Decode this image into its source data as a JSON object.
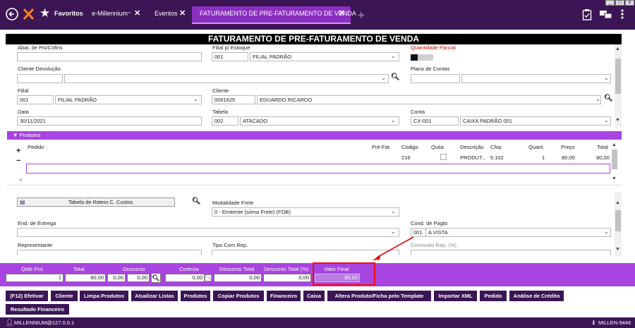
{
  "window": {
    "min": "_",
    "max": "□",
    "close": "x"
  },
  "topbar": {
    "favorites": "Favoritos",
    "tabs": [
      {
        "label": "e-Millennium"
      },
      {
        "label": "Eventos"
      },
      {
        "label": "FATURAMENTO DE PRE-FATURAMENTO DE VENDA"
      }
    ],
    "add_tab": "+"
  },
  "title": "FATURAMENTO DE PRE-FATURAMENTO DE VENDA",
  "header_form": {
    "abat": {
      "label": "Abat. de Pis/Cofins",
      "value": ""
    },
    "filial_estoque": {
      "label": "Filial p/ Estoque",
      "code": "001",
      "value": "FILIAL PADRÃO"
    },
    "qtd_parcial": {
      "label": "Quantidade Parcial"
    },
    "cliente_devolucao": {
      "label": "Cliente Devolução",
      "code": "",
      "value": ""
    },
    "plano_contas": {
      "label": "Plano de Contas",
      "code": "",
      "value": ""
    },
    "filial": {
      "label": "Filial",
      "code": "001",
      "value": "FILIAL PADRÃO"
    },
    "cliente": {
      "label": "Cliente",
      "code": "0061625",
      "value": "EDUARDO RICARDO"
    },
    "data": {
      "label": "Data",
      "value": "30/11/2021"
    },
    "tabela": {
      "label": "Tabela",
      "code": "002",
      "value": "ATACADO"
    },
    "conta": {
      "label": "Conta",
      "code": "CX-001",
      "value": "CAIXA PADRÃO 001"
    }
  },
  "produtos": {
    "title": "Produtos",
    "add": "+",
    "remove": "−",
    "more": "»",
    "columns": {
      "pedido": "Pedido",
      "pre_fat": "Pré-Fat.",
      "codigo": "Código",
      "quita": "Quita",
      "descricao": "Descrição",
      "cfop": "Cfop",
      "quant": "Quant.",
      "preco": "Preço",
      "total": "Total"
    },
    "rows": [
      {
        "pedido": "",
        "pre_fat": "",
        "codigo": "216",
        "descricao": "PRODUT...",
        "cfop": "5.102",
        "quant": "1",
        "preco": "80,00",
        "total": "80,00"
      }
    ]
  },
  "lower_form": {
    "rateio_btn": "Tabela de Rateio C. Custos",
    "modalidade_frete": {
      "label": "Modalidade Frete",
      "value": "0 - Emitente (soma Frete) (FOB)"
    },
    "end_entrega": {
      "label": "End. de Entrega",
      "value": ""
    },
    "cond_pagto": {
      "label": "Cond. de Pagto",
      "code": "001",
      "value": "A VISTA"
    },
    "representante": {
      "label": "Representante",
      "value": ""
    },
    "tipo_com_rep": {
      "label": "Tipo Com.Rep.",
      "value": ""
    },
    "comissao_rep": {
      "label": "Comissão Rep. (%)",
      "value": ""
    }
  },
  "summary": {
    "qtde_pcs": {
      "label": "Qtde Pcs",
      "value": "1"
    },
    "total": {
      "label": "Total",
      "value": "80,00"
    },
    "desconto": {
      "label": "Desconto",
      "value1": "0,00",
      "value2": "0,00"
    },
    "cortesia": {
      "label": "Cortesia",
      "value": "0,00"
    },
    "desconto_total": {
      "label": "Desconto Total",
      "value": "0,00"
    },
    "desconto_total_pct": {
      "label": "Desconto Total (%)",
      "value": "0,00"
    },
    "valor_final": {
      "label": "Valor Final",
      "value": "80,00"
    }
  },
  "buttons": [
    "(F12) Efetivar",
    "Cliente",
    "Limpa Produtos",
    "Atualizar Listas",
    "Produtos",
    "Copiar Produtos",
    "Financeiro",
    "Caixa",
    "Altera Produto/Ficha pelo Template",
    "Importar XML",
    "Pedido",
    "Análise de Crédito",
    "Resultado Financeiro"
  ],
  "status": {
    "user": "MILLENNIUM@127.0.0.1",
    "server": "MILLEN-9446"
  },
  "colors": {
    "dark": "#3b1554",
    "accent": "#a844e0",
    "highlight": "#e11111"
  }
}
